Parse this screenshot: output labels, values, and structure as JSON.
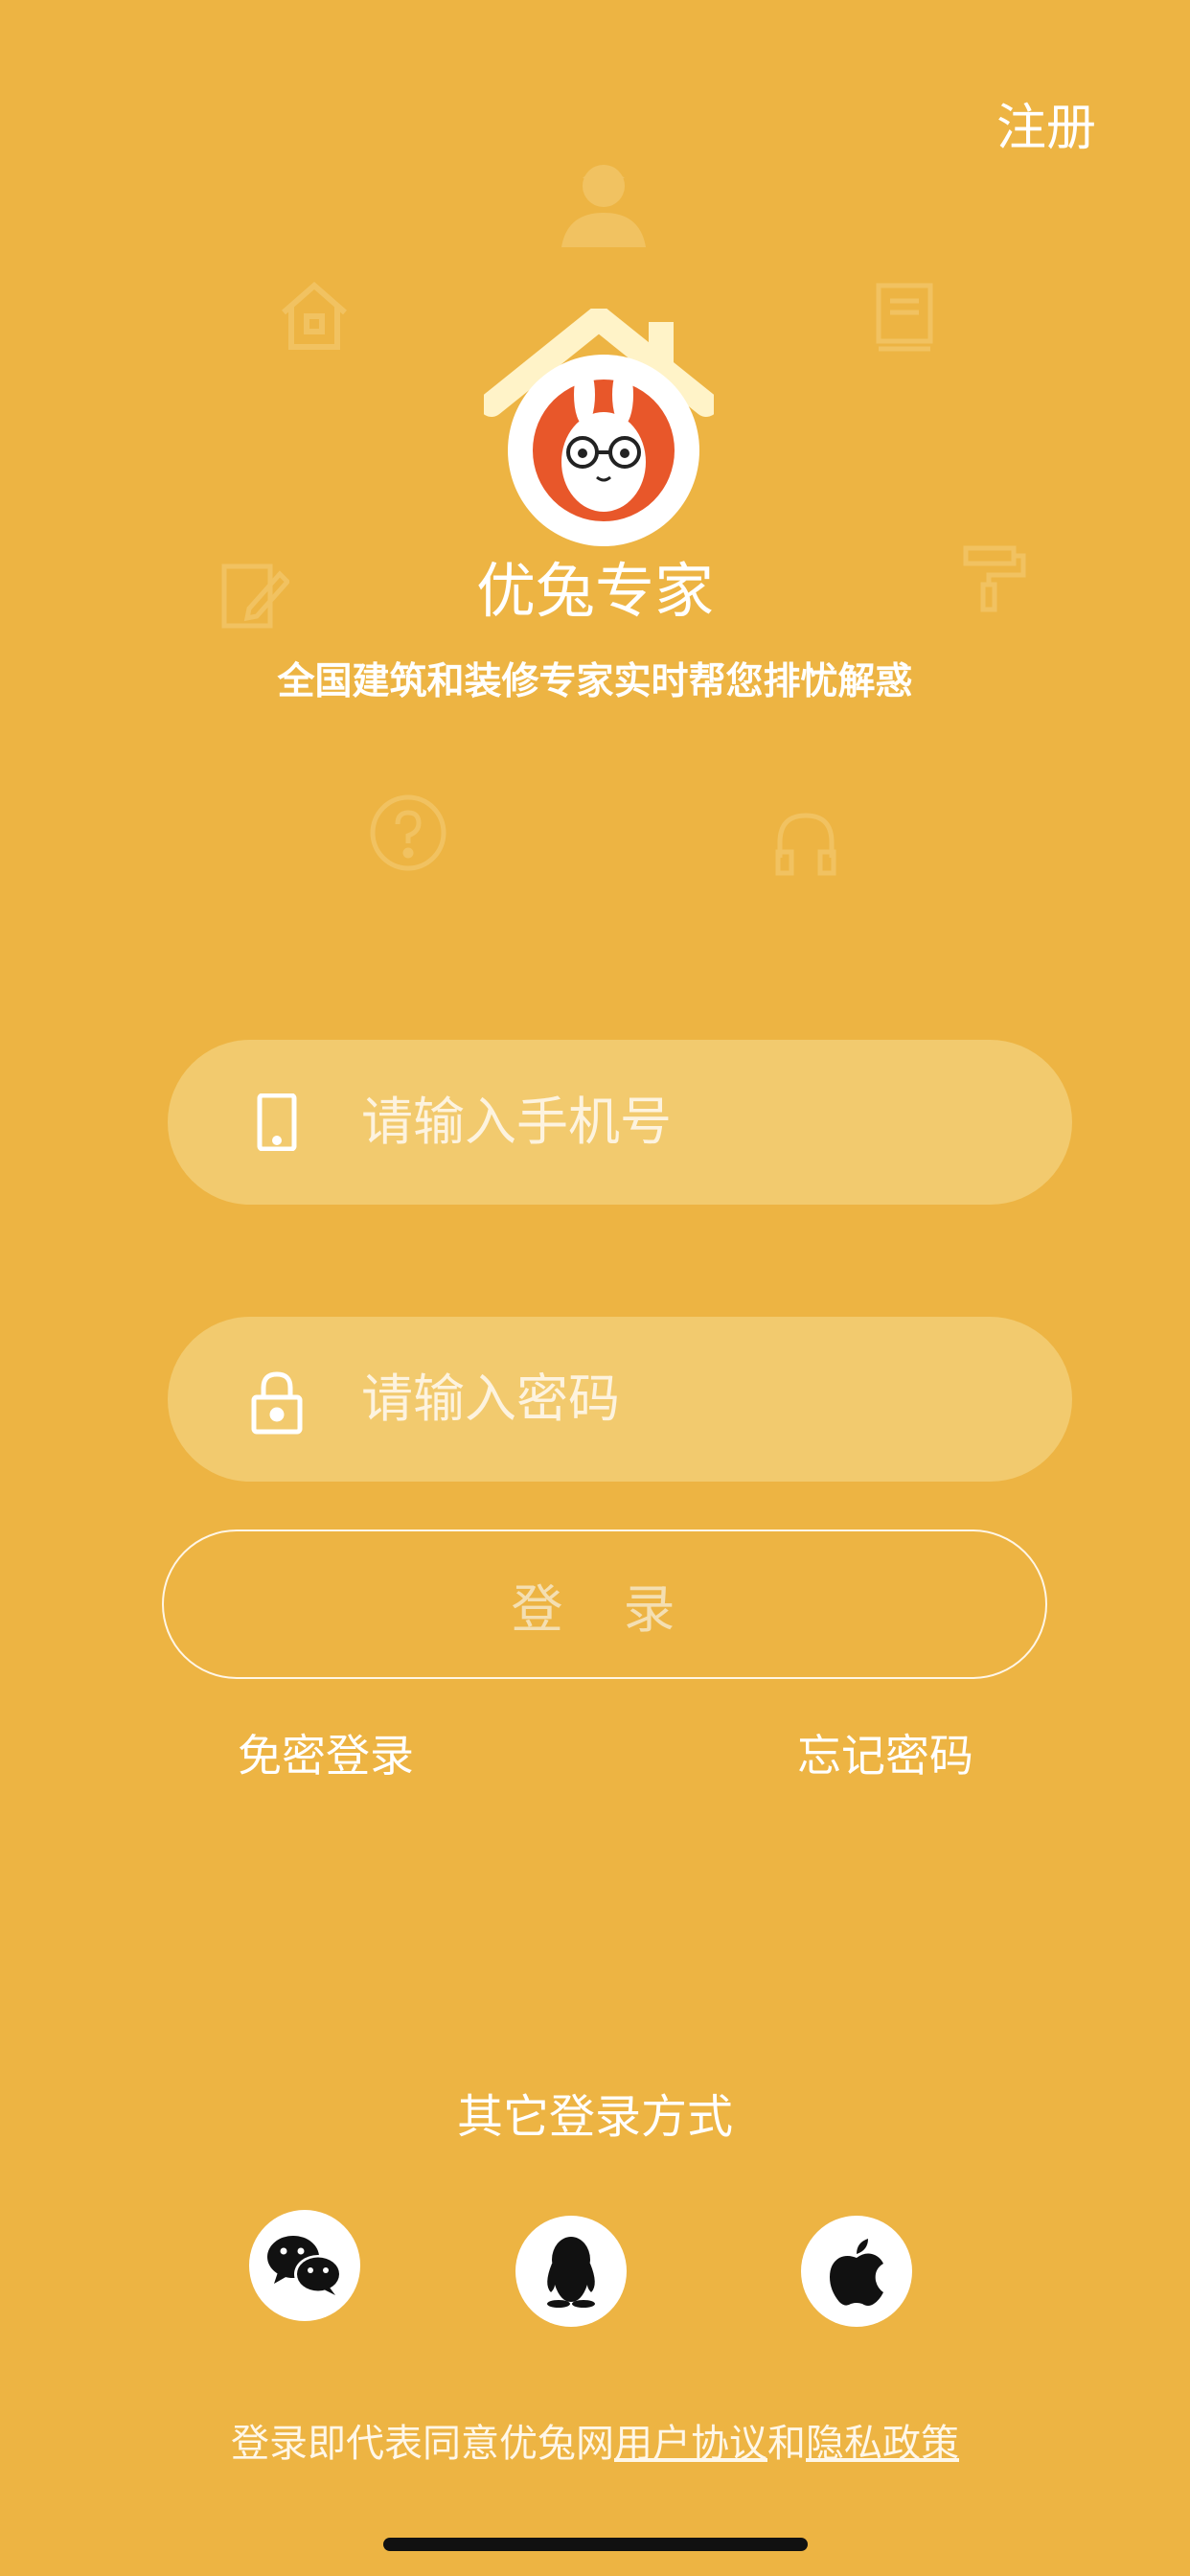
{
  "header": {
    "register_label": "注册"
  },
  "brand": {
    "name": "优兔专家",
    "tagline": "全国建筑和装修专家实时帮您排忧解惑"
  },
  "decor_icons": [
    "worker-icon",
    "house-icon",
    "book-icon",
    "edit-icon",
    "paint-roller-icon",
    "question-icon",
    "headset-icon"
  ],
  "form": {
    "phone_placeholder": "请输入手机号",
    "password_placeholder": "请输入密码",
    "login_label": "登 录",
    "passwordless_label": "免密登录",
    "forgot_label": "忘记密码"
  },
  "other_login": {
    "title": "其它登录方式",
    "providers": [
      "wechat-icon",
      "qq-icon",
      "apple-icon"
    ]
  },
  "agreement": {
    "prefix": "登录即代表同意优兔网",
    "user_agreement": "用户协议",
    "and": "和",
    "privacy_policy": "隐私政策"
  },
  "colors": {
    "background": "#EDB443",
    "field": "#F2CA6E",
    "logo_orange": "#E8572A"
  }
}
